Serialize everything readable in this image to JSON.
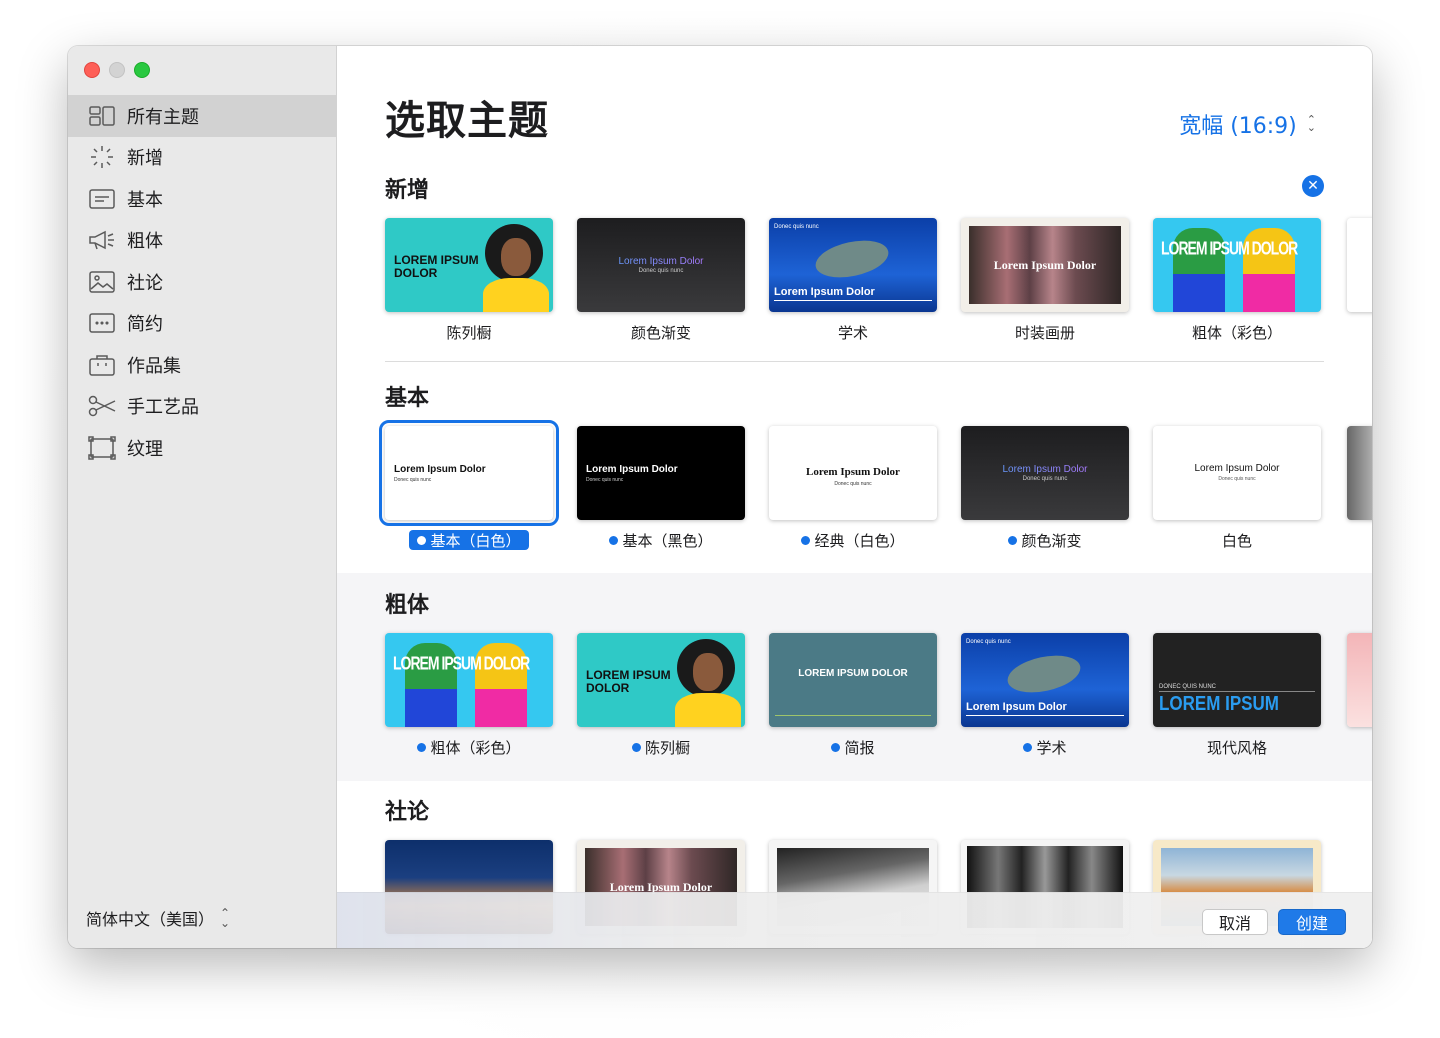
{
  "sidebar": {
    "items": [
      {
        "label": "所有主题",
        "icon": "all-themes-icon",
        "active": true
      },
      {
        "label": "新增",
        "icon": "sparkle-icon",
        "active": false
      },
      {
        "label": "基本",
        "icon": "basic-slide-icon",
        "active": false
      },
      {
        "label": "粗体",
        "icon": "megaphone-icon",
        "active": false
      },
      {
        "label": "社论",
        "icon": "photo-icon",
        "active": false
      },
      {
        "label": "简约",
        "icon": "ellipsis-box-icon",
        "active": false
      },
      {
        "label": "作品集",
        "icon": "briefcase-icon",
        "active": false
      },
      {
        "label": "手工艺品",
        "icon": "scissors-icon",
        "active": false
      },
      {
        "label": "纹理",
        "icon": "texture-frame-icon",
        "active": false
      }
    ],
    "language": "简体中文（美国）"
  },
  "header": {
    "title": "选取主题",
    "aspect": "宽幅 (16:9)"
  },
  "sections": {
    "new": {
      "title": "新增",
      "themes": [
        "陈列橱",
        "颜色渐变",
        "学术",
        "时装画册",
        "粗体（彩色）"
      ],
      "slide_text": {
        "showcase": "LOREM IPSUM DOLOR",
        "gradient": "Lorem Ipsum Dolor",
        "gradient_sub": "Donec quis nunc",
        "academy_top": "Donec quis nunc",
        "academy": "Lorem Ipsum Dolor",
        "lookbook": "Lorem Ipsum Dolor",
        "bold_color": "LOREM IPSUM DOLOR"
      }
    },
    "basic": {
      "title": "基本",
      "themes": [
        "基本（白色）",
        "基本（黑色）",
        "经典（白色）",
        "颜色渐变",
        "白色"
      ],
      "slide_title": "Lorem Ipsum Dolor",
      "slide_sub": "Donec quis nunc"
    },
    "bold": {
      "title": "粗体",
      "themes": [
        "粗体（彩色）",
        "陈列橱",
        "简报",
        "学术",
        "现代风格"
      ],
      "slide_text": {
        "bold_color": "LOREM IPSUM DOLOR",
        "showcase": "LOREM IPSUM DOLOR",
        "briefing": "LOREM IPSUM DOLOR",
        "academy_top": "Donec quis nunc",
        "academy": "Lorem Ipsum Dolor",
        "modern_top": "DONEC QUIS NUNC",
        "modern": "LOREM IPSUM"
      }
    },
    "editorial": {
      "title": "社论",
      "slide_text": {
        "lookbook": "Lorem Ipsum Dolor"
      }
    }
  },
  "footer": {
    "cancel": "取消",
    "create": "创建"
  },
  "colors": {
    "accent": "#1672e6",
    "sidebar_bg": "#e9e9e9",
    "teal": "#2fc7c9"
  }
}
